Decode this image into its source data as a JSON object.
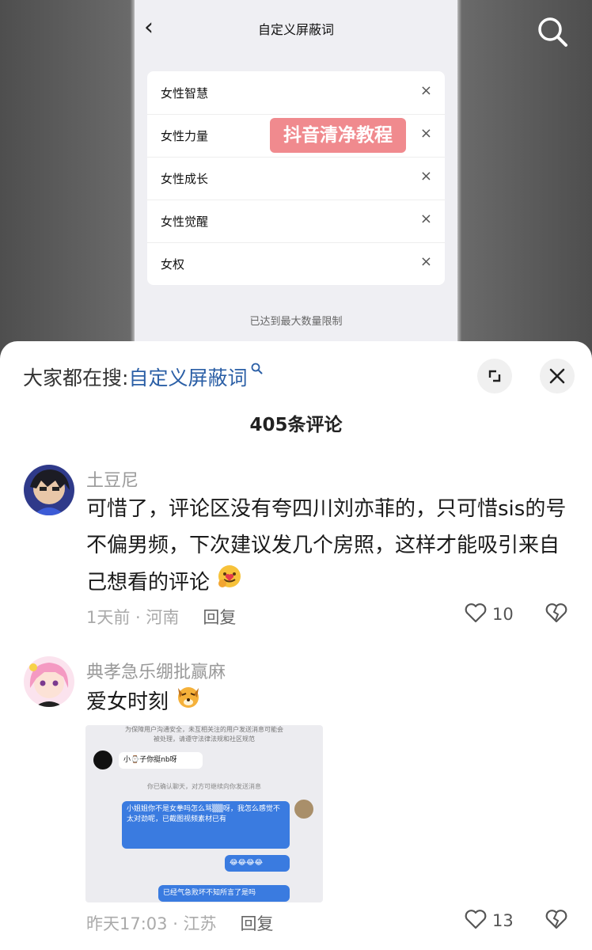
{
  "background": {
    "phone_title": "自定义屏蔽词",
    "blocked_words": [
      "女性智慧",
      "女性力量",
      "女性成长",
      "女性觉醒",
      "女权"
    ],
    "remove_glyph": "×",
    "limit_note": "已达到最大数量限制",
    "watermark": "抖音清净教程"
  },
  "sheet": {
    "hot_search_prefix": "大家都在搜:",
    "hot_search_keyword": "自定义屏蔽词",
    "comment_count_title": "405条评论"
  },
  "comments": [
    {
      "user": "土豆尼",
      "text": "可惜了，评论区没有夸四川刘亦菲的，只可惜sis的号不偏男频，下次建议发几个房照，这样才能吸引来自己想看的评论",
      "emoji": "hug-face-emoji",
      "time_location": "1天前 · 河南",
      "reply_label": "回复",
      "likes": "10"
    },
    {
      "user": "典孝急乐绷批赢麻",
      "text": "爱女时刻",
      "emoji": "dog-face-emoji",
      "time_location": "昨天17:03 · 江苏",
      "reply_label": "回复",
      "likes": "13",
      "image": {
        "top_notice_1": "为保障用户沟通安全，未互相关注的用户发送消息可能会",
        "top_notice_2": "被处理，请遵守法律法规和社区规范",
        "incoming_1": "小⌚子你挺nb呀",
        "system_1": "你已确认聊天，对方可继续向你发送消息",
        "outgoing_1": "小姐姐你不是女拳吗怎么骂▒▒呀，我怎么感觉不太对劲呢，已截图视频素材已有",
        "outgoing_2": "😂😂😂😂",
        "outgoing_3": "已经气急败坏不知所言了是吗"
      }
    }
  ],
  "colors": {
    "keyword_blue": "#2b5fa6",
    "watermark_pink": "#f08a8e",
    "chat_blue": "#3a7be0"
  }
}
